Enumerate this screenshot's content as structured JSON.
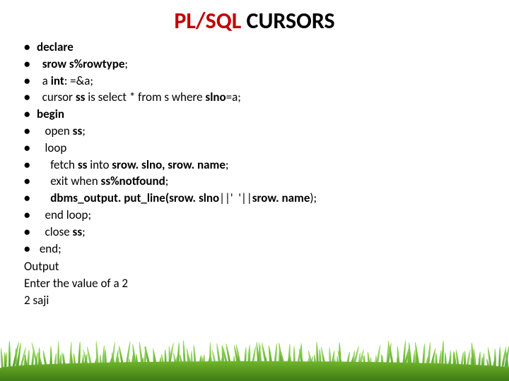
{
  "title": {
    "accent": "PL/SQL",
    "rest": " CURSORS"
  },
  "lines": [
    {
      "pre": "",
      "b1": "declare",
      "mid": "",
      "b2": "",
      "post": ""
    },
    {
      "pre": "  ",
      "b1": "srow",
      "mid": " ",
      "b2": "s%rowtype",
      "post": ";"
    },
    {
      "pre": "  a ",
      "b1": "int",
      "mid": ": =&a;",
      "b2": "",
      "post": ""
    },
    {
      "pre": "  cursor ",
      "b1": "ss",
      "mid": " is select * from s where ",
      "b2": "slno",
      "post": "=a;"
    },
    {
      "pre": "",
      "b1": "begin",
      "mid": "",
      "b2": "",
      "post": ""
    },
    {
      "pre": "   open ",
      "b1": "ss",
      "mid": ";",
      "b2": "",
      "post": ""
    },
    {
      "pre": "   loop",
      "b1": "",
      "mid": "",
      "b2": "",
      "post": ""
    },
    {
      "pre": "     fetch ",
      "b1": "ss",
      "mid": " into ",
      "b2": "srow. slno, srow. name",
      "post": ";"
    },
    {
      "pre": "     exit when ",
      "b1": "ss%notfound",
      "mid": ";",
      "b2": "",
      "post": ""
    },
    {
      "pre": "     ",
      "b1": "dbms_output. put_line(srow. slno",
      "mid": "||'  '||",
      "b2": "srow. name",
      "post": ");"
    },
    {
      "pre": "   end loop;",
      "b1": "",
      "mid": "",
      "b2": "",
      "post": ""
    },
    {
      "pre": "   close ",
      "b1": "ss",
      "mid": ";",
      "b2": "",
      "post": ""
    },
    {
      "pre": " end;",
      "b1": "",
      "mid": "",
      "b2": "",
      "post": ""
    }
  ],
  "output": {
    "label": "Output",
    "line1": "Enter the value of a 2",
    "line2": "2 saji"
  }
}
